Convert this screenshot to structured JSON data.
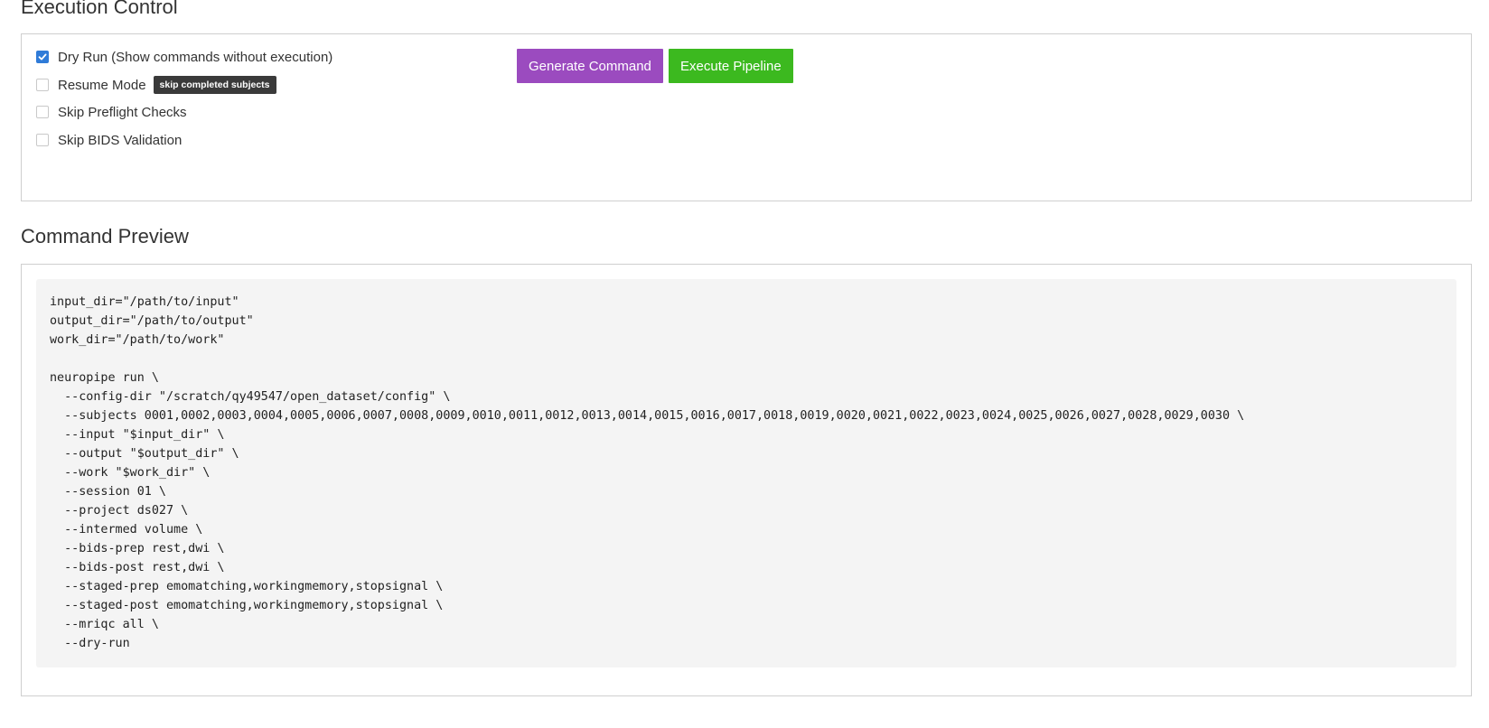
{
  "execution_control": {
    "title": "Execution Control",
    "options": [
      {
        "label": "Dry Run (Show commands without execution)",
        "checked": true,
        "badge": ""
      },
      {
        "label": "Resume Mode",
        "checked": false,
        "badge": "skip completed subjects"
      },
      {
        "label": "Skip Preflight Checks",
        "checked": false,
        "badge": ""
      },
      {
        "label": "Skip BIDS Validation",
        "checked": false,
        "badge": ""
      }
    ],
    "buttons": {
      "generate_label": "Generate Command",
      "execute_label": "Execute Pipeline"
    }
  },
  "command_preview": {
    "title": "Command Preview",
    "code": "input_dir=\"/path/to/input\"\noutput_dir=\"/path/to/output\"\nwork_dir=\"/path/to/work\"\n\nneuropipe run \\\n  --config-dir \"/scratch/qy49547/open_dataset/config\" \\\n  --subjects 0001,0002,0003,0004,0005,0006,0007,0008,0009,0010,0011,0012,0013,0014,0015,0016,0017,0018,0019,0020,0021,0022,0023,0024,0025,0026,0027,0028,0029,0030 \\\n  --input \"$input_dir\" \\\n  --output \"$output_dir\" \\\n  --work \"$work_dir\" \\\n  --session 01 \\\n  --project ds027 \\\n  --intermed volume \\\n  --bids-prep rest,dwi \\\n  --bids-post rest,dwi \\\n  --staged-prep emomatching,workingmemory,stopsignal \\\n  --staged-post emomatching,workingmemory,stopsignal \\\n  --mriqc all \\\n  --dry-run"
  },
  "colors": {
    "checkbox_checked": "#2f7bd8",
    "generate_button": "#9b4bbf",
    "execute_button": "#3cb91f",
    "badge_bg": "#3a3a3a",
    "code_bg": "#f4f4f4"
  },
  "icons": {
    "checkmark": "check-icon"
  }
}
